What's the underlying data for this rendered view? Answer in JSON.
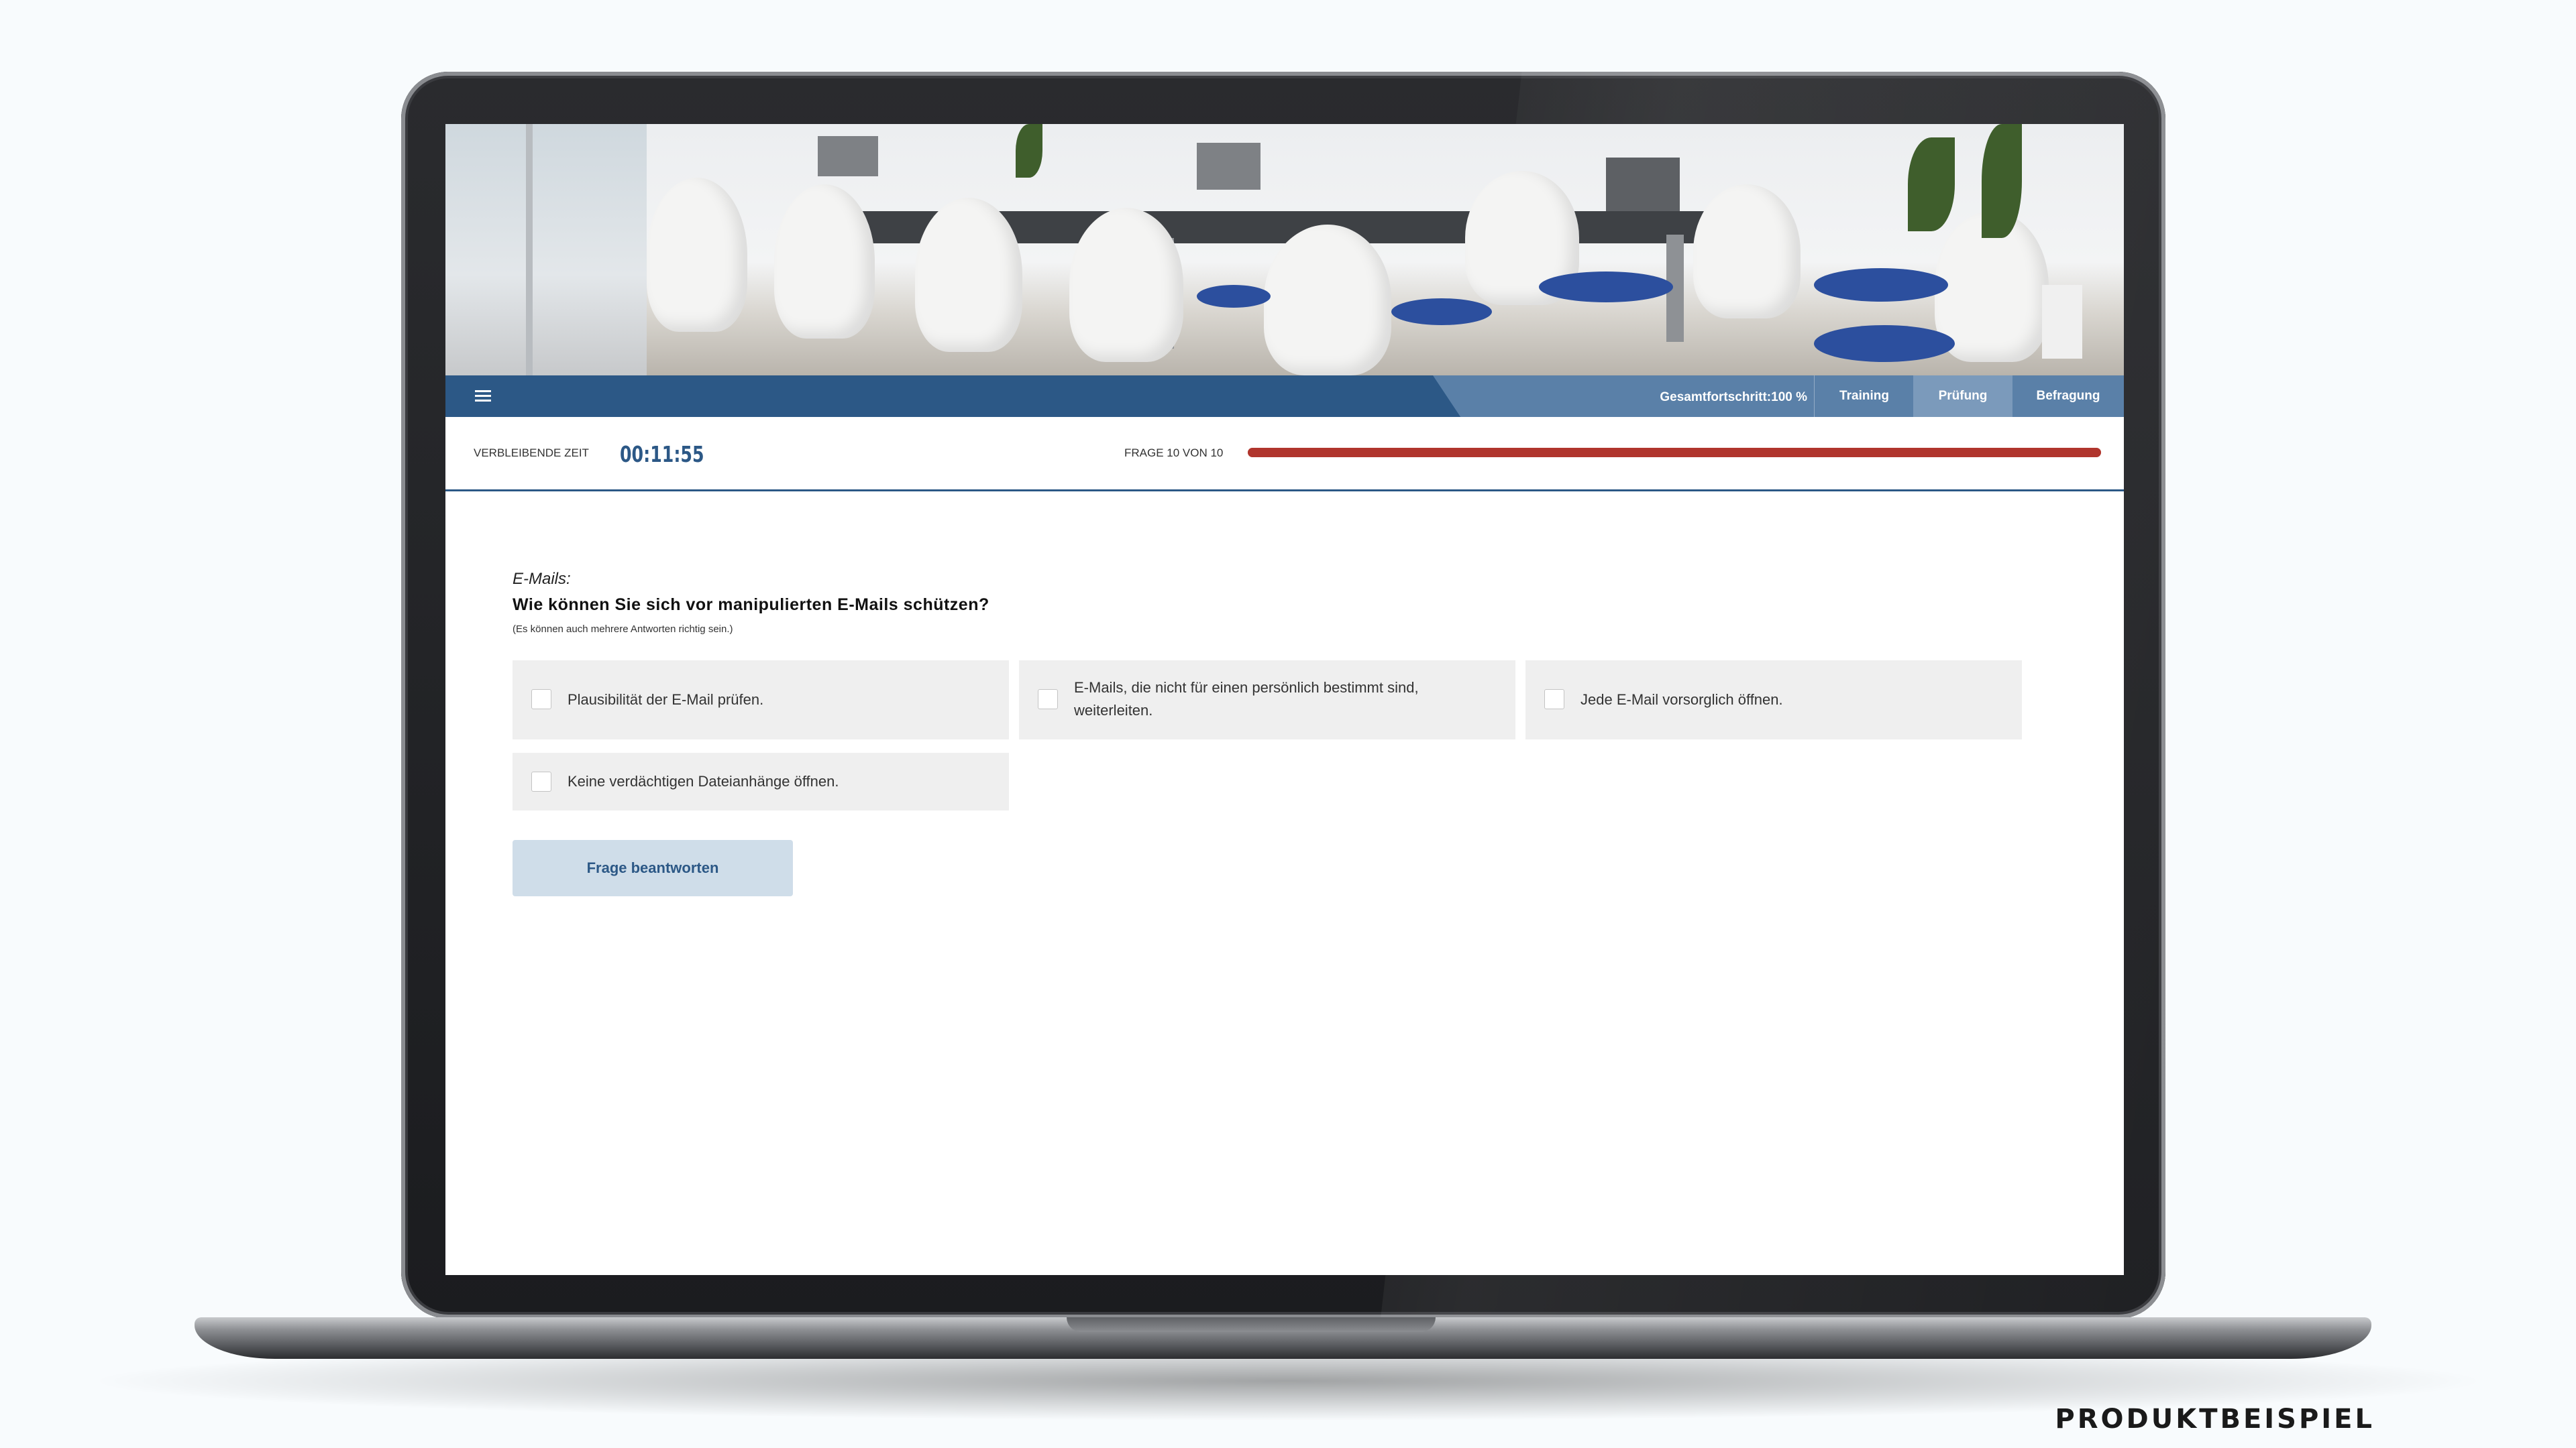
{
  "nav": {
    "overall_progress": "Gesamtfortschritt:100 %",
    "tabs": [
      {
        "label": "Training"
      },
      {
        "label": "Prüfung"
      },
      {
        "label": "Befragung"
      }
    ],
    "active_tab": "Prüfung"
  },
  "status": {
    "time_label": "VERBLEIBENDE ZEIT",
    "time_value": "00:11:55",
    "question_counter": "FRAGE 10 VON 10",
    "question_progress": 1.0
  },
  "question": {
    "category": "E-Mails:",
    "text": "Wie können Sie sich vor manipulierten E-Mails schützen?",
    "hint": "(Es können auch mehrere Antworten richtig sein.)",
    "answers": [
      {
        "label": "Plausibilität der E-Mail prüfen.",
        "checked": false
      },
      {
        "label": "E-Mails, die nicht für einen persönlich bestimmt sind, weiterleiten.",
        "checked": false
      },
      {
        "label": "Jede E-Mail vorsorglich öffnen.",
        "checked": false
      },
      {
        "label": "Keine verdächtigen Dateianhänge öffnen.",
        "checked": false
      }
    ],
    "submit_label": "Frage beantworten"
  },
  "footer": {
    "label": "PRODUKTBEISPIEL"
  },
  "colors": {
    "nav_bg": "#2c5886",
    "nav_active_tab": "#7b9abb",
    "progress_bar": "#b0352d",
    "submit_bg": "#cfdde9"
  }
}
